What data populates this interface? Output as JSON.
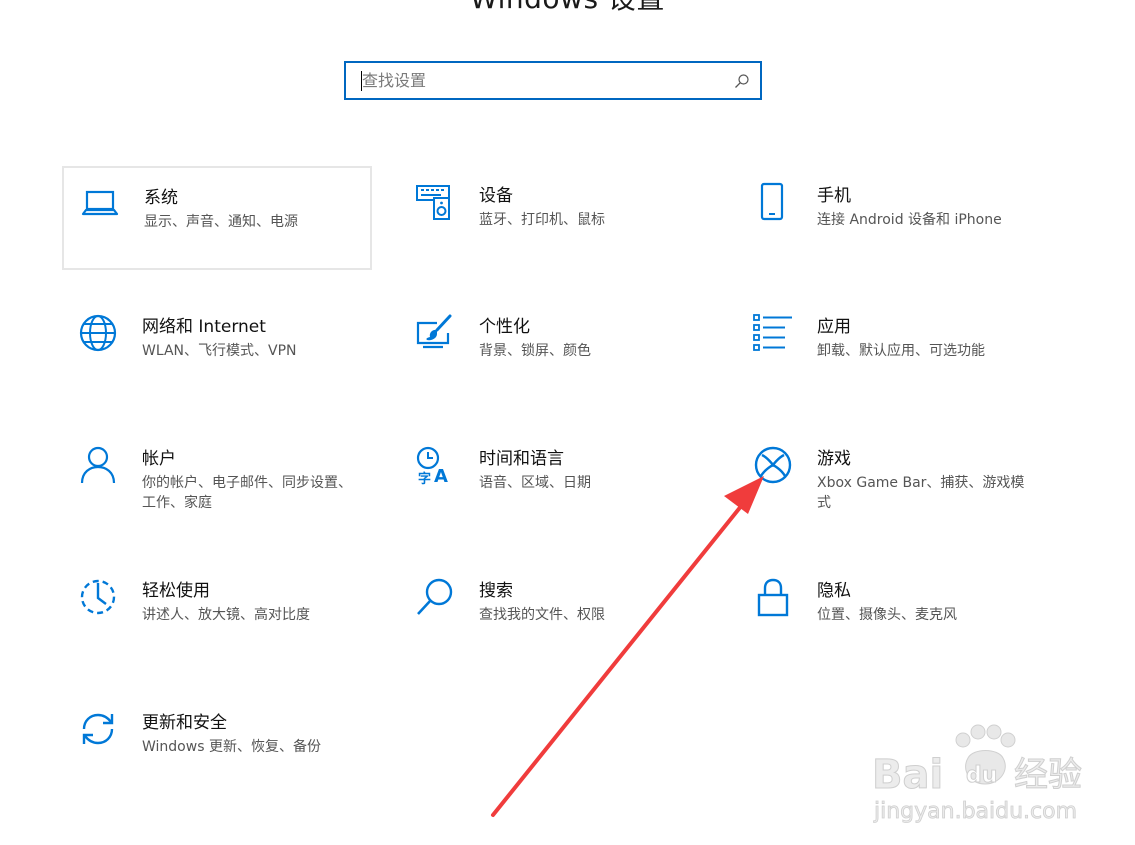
{
  "header": {
    "title": "Windows 设置"
  },
  "search": {
    "placeholder": "查找设置"
  },
  "tiles": [
    {
      "title": "系统",
      "desc": "显示、声音、通知、电源",
      "icon": "laptop-icon"
    },
    {
      "title": "设备",
      "desc": "蓝牙、打印机、鼠标",
      "icon": "devices-icon"
    },
    {
      "title": "手机",
      "desc": "连接 Android 设备和 iPhone",
      "icon": "phone-icon"
    },
    {
      "title": "网络和 Internet",
      "desc": "WLAN、飞行模式、VPN",
      "icon": "globe-icon"
    },
    {
      "title": "个性化",
      "desc": "背景、锁屏、颜色",
      "icon": "paint-icon"
    },
    {
      "title": "应用",
      "desc": "卸载、默认应用、可选功能",
      "icon": "apps-list-icon"
    },
    {
      "title": "帐户",
      "desc": "你的帐户、电子邮件、同步设置、工作、家庭",
      "icon": "person-icon"
    },
    {
      "title": "时间和语言",
      "desc": "语音、区域、日期",
      "icon": "time-language-icon"
    },
    {
      "title": "游戏",
      "desc": "Xbox Game Bar、捕获、游戏模式",
      "icon": "xbox-icon"
    },
    {
      "title": "轻松使用",
      "desc": "讲述人、放大镜、高对比度",
      "icon": "ease-of-access-icon"
    },
    {
      "title": "搜索",
      "desc": "查找我的文件、权限",
      "icon": "search-icon"
    },
    {
      "title": "隐私",
      "desc": "位置、摄像头、麦克风",
      "icon": "lock-icon"
    },
    {
      "title": "更新和安全",
      "desc": "Windows 更新、恢复、备份",
      "icon": "sync-icon"
    }
  ],
  "watermark": {
    "brand": "Bai",
    "brand2": "du",
    "label": "经验",
    "url": "jingyan.baidu.com"
  },
  "colors": {
    "accent": "#0067c0",
    "icon": "#0078d7",
    "arrow": "#f03c3c"
  }
}
